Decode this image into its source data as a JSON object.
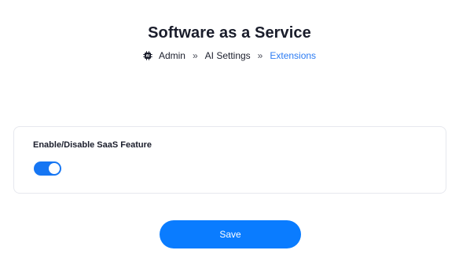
{
  "header": {
    "title": "Software as a Service"
  },
  "breadcrumb": {
    "icon": "ai-chip-icon",
    "icon_text": "AI",
    "items": [
      "Admin",
      "AI Settings",
      "Extensions"
    ],
    "separator": "»"
  },
  "settings": {
    "saas_toggle_label": "Enable/Disable SaaS Feature",
    "saas_enabled": true
  },
  "actions": {
    "save_label": "Save"
  },
  "colors": {
    "accent": "#0a7cff",
    "breadcrumb_current": "#2b7bf3",
    "toggle_on": "#1676f3"
  }
}
